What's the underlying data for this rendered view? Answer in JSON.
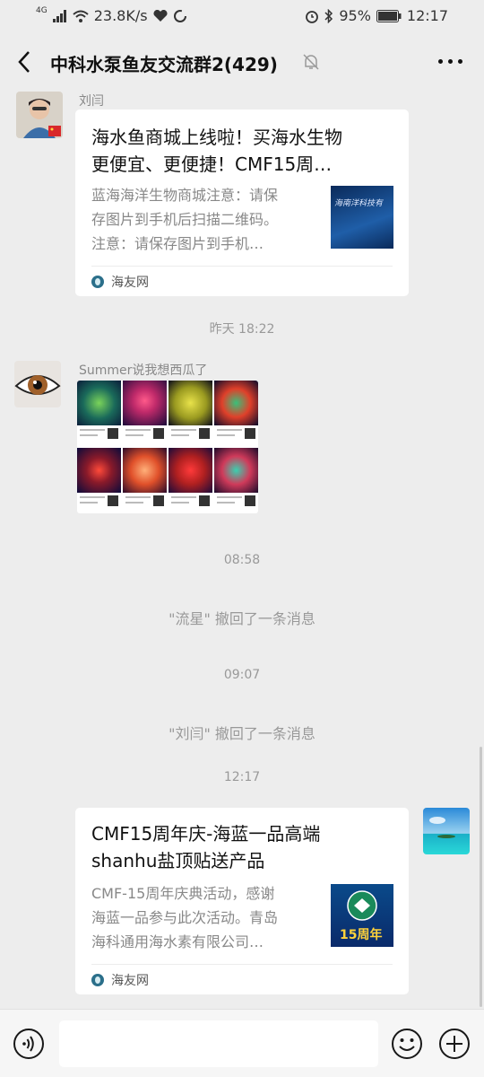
{
  "status": {
    "network": "4G",
    "speed": "23.8K/s",
    "battery": "95%",
    "time": "12:17"
  },
  "header": {
    "title": "中科水泵鱼友交流群2(429)"
  },
  "messages": {
    "m1": {
      "sender": "刘闫",
      "title_line1": "海水鱼商城上线啦！买海水生物",
      "title_line2": "更便宜、更便捷！CMF15周…",
      "desc_line1": "蓝海海洋生物商城注意：请保",
      "desc_line2": "存图片到手机后扫描二维码。",
      "desc_line3": "注意：请保存图片到手机…",
      "thumb_text": "海南洋科技有",
      "source": "海友网"
    },
    "t1": "昨天 18:22",
    "m2": {
      "sender": "Summer说我想西瓜了"
    },
    "t2": "08:58",
    "r1": "\"流星\" 撤回了一条消息",
    "t3": "09:07",
    "r2": "\"刘闫\" 撤回了一条消息",
    "t4": "12:17",
    "m3": {
      "title_line1": "CMF15周年庆-海蓝一品高端",
      "title_line2": "shanhu盐顶贴送产品",
      "desc_line1": "CMF-15周年庆典活动，感谢",
      "desc_line2": "海蓝一品参与此次活动。青岛",
      "desc_line3": "海科通用海水素有限公司…",
      "thumb_text": "15周年",
      "source": "海友网"
    }
  },
  "colors": {
    "background": "#ededed",
    "bubble": "#ffffff",
    "muted_text": "#999999"
  }
}
